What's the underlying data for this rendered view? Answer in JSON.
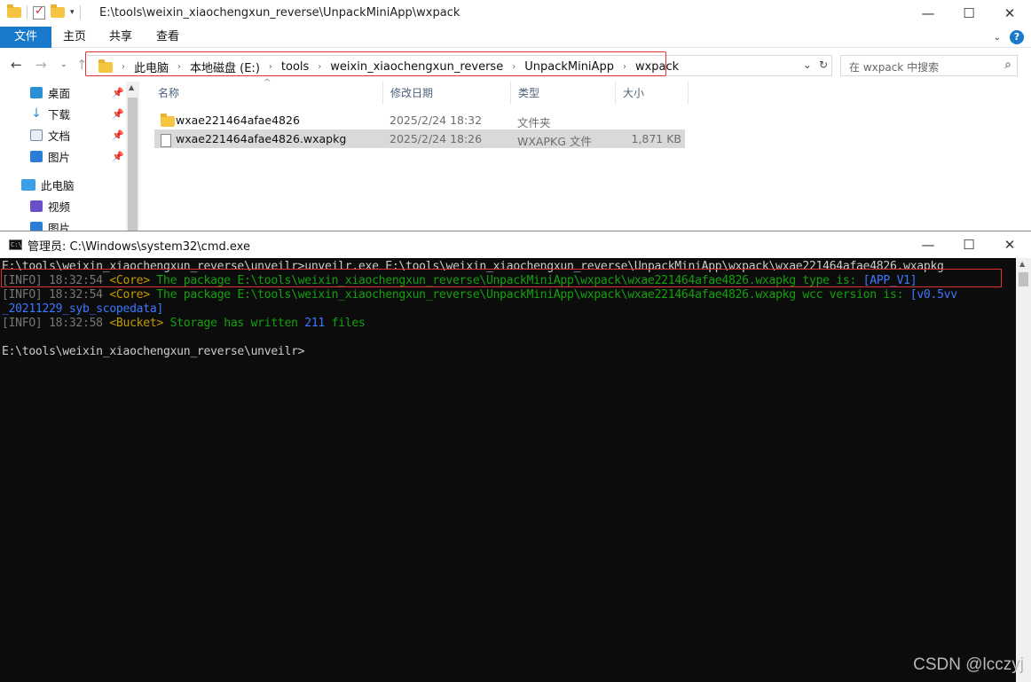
{
  "explorer": {
    "title_path": "E:\\tools\\weixin_xiaochengxun_reverse\\UnpackMiniApp\\wxpack",
    "ribbon_tabs": [
      "文件",
      "主页",
      "共享",
      "查看"
    ],
    "breadcrumbs": [
      "此电脑",
      "本地磁盘 (E:)",
      "tools",
      "weixin_xiaochengxun_reverse",
      "UnpackMiniApp",
      "wxpack"
    ],
    "search_placeholder": "在 wxpack 中搜索",
    "nav_items": [
      {
        "label": "桌面",
        "icon": "desktop-icon",
        "pinned": true
      },
      {
        "label": "下载",
        "icon": "download-icon",
        "pinned": true
      },
      {
        "label": "文档",
        "icon": "document-icon",
        "pinned": true
      },
      {
        "label": "图片",
        "icon": "picture-icon",
        "pinned": true
      },
      {
        "label": "此电脑",
        "icon": "computer-icon",
        "pinned": false
      },
      {
        "label": "视频",
        "icon": "video-icon",
        "pinned": false
      },
      {
        "label": "图片",
        "icon": "picture-icon",
        "pinned": false
      }
    ],
    "columns": {
      "name": "名称",
      "date": "修改日期",
      "type": "类型",
      "size": "大小"
    },
    "files": [
      {
        "name": "wxae221464afae4826",
        "date": "2025/2/24 18:32",
        "type": "文件夹",
        "size": "",
        "icon": "folder-icon",
        "selected": false
      },
      {
        "name": "wxae221464afae4826.wxapkg",
        "date": "2025/2/24 18:26",
        "type": "WXAPKG 文件",
        "size": "1,871 KB",
        "icon": "file-icon",
        "selected": true
      }
    ]
  },
  "cmd": {
    "title": "管理员: C:\\Windows\\system32\\cmd.exe",
    "lines": [
      [
        {
          "t": "E:\\tools\\weixin_xiaochengxun_reverse\\unveilr>unveilr.exe E:\\tools\\weixin_xiaochengxun_reverse\\UnpackMiniApp\\wxpack\\wxae221464afae4826.wxapkg",
          "c": "white"
        }
      ],
      [
        {
          "t": "[INFO]",
          "c": "grey"
        },
        {
          "t": " 18:32:54 ",
          "c": "grey"
        },
        {
          "t": "<Core>",
          "c": "orange"
        },
        {
          "t": " The package E:\\tools\\weixin_xiaochengxun_reverse\\UnpackMiniApp\\wxpack\\wxae221464afae4826.wxapkg type is: ",
          "c": "green"
        },
        {
          "t": "[APP_V1]",
          "c": "blue"
        }
      ],
      [
        {
          "t": "[INFO]",
          "c": "grey"
        },
        {
          "t": " 18:32:54 ",
          "c": "grey"
        },
        {
          "t": "<Core>",
          "c": "orange"
        },
        {
          "t": " The package E:\\tools\\weixin_xiaochengxun_reverse\\UnpackMiniApp\\wxpack\\wxae221464afae4826.wxapkg wcc version is: ",
          "c": "green"
        },
        {
          "t": "[v0.5vv",
          "c": "blue"
        }
      ],
      [
        {
          "t": "_20211229_syb_scopedata]",
          "c": "blue"
        }
      ],
      [
        {
          "t": "[INFO]",
          "c": "grey"
        },
        {
          "t": " 18:32:58 ",
          "c": "grey"
        },
        {
          "t": "<Bucket>",
          "c": "orange"
        },
        {
          "t": " Storage has written ",
          "c": "green"
        },
        {
          "t": "211",
          "c": "blue"
        },
        {
          "t": " files",
          "c": "green"
        }
      ],
      [
        {
          "t": "",
          "c": "white"
        }
      ],
      [
        {
          "t": "E:\\tools\\weixin_xiaochengxun_reverse\\unveilr>",
          "c": "white"
        }
      ]
    ]
  },
  "watermark": "CSDN @lcczyj"
}
